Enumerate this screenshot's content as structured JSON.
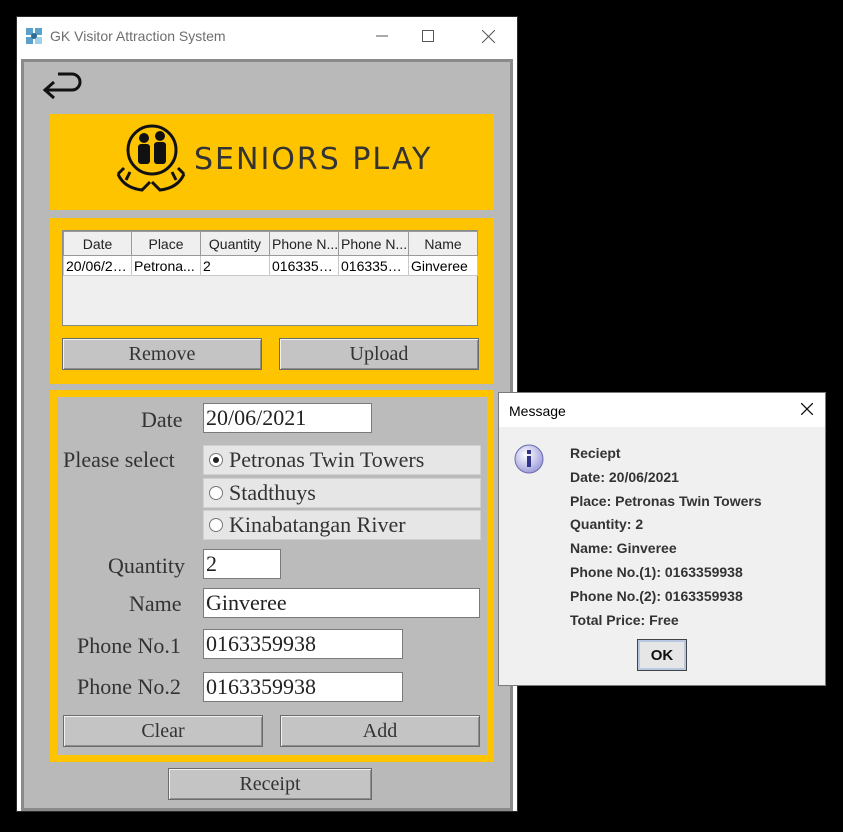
{
  "window": {
    "title": "GK Visitor Attraction System"
  },
  "banner": {
    "title": "SENIORS PLAY"
  },
  "table": {
    "columns": [
      "Date",
      "Place",
      "Quantity",
      "Phone N...",
      "Phone N...",
      "Name"
    ],
    "rows": [
      [
        "20/06/20...",
        "Petrona...",
        "2",
        "0163359...",
        "0163359...",
        "Ginveree"
      ]
    ]
  },
  "buttons": {
    "remove": "Remove",
    "upload": "Upload",
    "clear": "Clear",
    "add": "Add",
    "receipt": "Receipt"
  },
  "form": {
    "date_label": "Date",
    "date_value": "20/06/2021",
    "select_label": "Please select",
    "places": [
      {
        "label": "Petronas Twin Towers",
        "selected": true
      },
      {
        "label": "Stadthuys",
        "selected": false
      },
      {
        "label": "Kinabatangan River",
        "selected": false
      }
    ],
    "quantity_label": "Quantity",
    "quantity_value": "2",
    "name_label": "Name",
    "name_value": "Ginveree",
    "phone1_label": "Phone No.1",
    "phone1_value": "0163359938",
    "phone2_label": "Phone No.2",
    "phone2_value": "0163359938"
  },
  "dialog": {
    "title": "Message",
    "lines": [
      "Reciept",
      "Date: 20/06/2021",
      "Place: Petronas Twin Towers",
      "Quantity: 2",
      "Name: Ginveree",
      "Phone No.(1): 0163359938",
      "Phone No.(2): 0163359938",
      "Total Price: Free"
    ],
    "ok": "OK"
  },
  "colors": {
    "panel_yellow": "#ffc400",
    "form_grey": "#bbbbbb"
  }
}
